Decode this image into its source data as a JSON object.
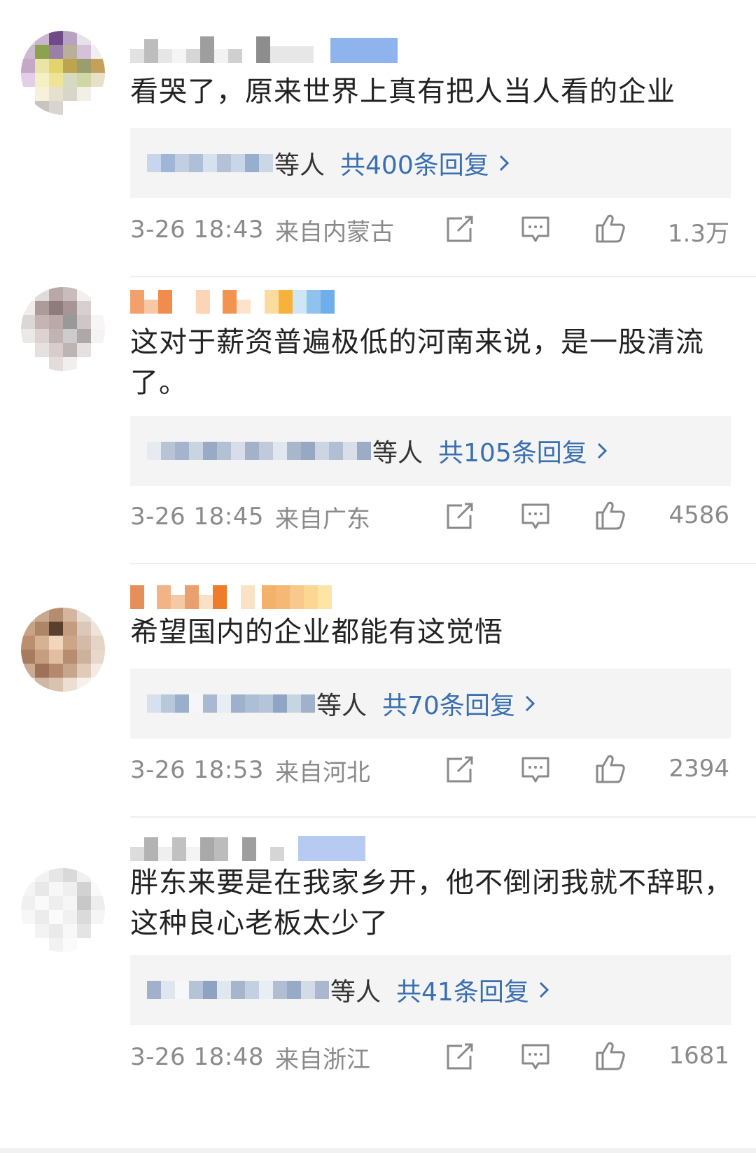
{
  "comments": [
    {
      "text": "看哭了，原来世界上真有把人当人看的企业",
      "reply_etc": "等人",
      "reply_total": "共400条回复",
      "time": "3-26 18:43",
      "origin": "来自内蒙古",
      "likes": "1.3万"
    },
    {
      "text": "这对于薪资普遍极低的河南来说，是一股清流了。",
      "reply_etc": "等人",
      "reply_total": "共105条回复",
      "time": "3-26 18:45",
      "origin": "来自广东",
      "likes": "4586"
    },
    {
      "text": "希望国内的企业都能有这觉悟",
      "reply_etc": "等人",
      "reply_total": "共70条回复",
      "time": "3-26 18:53",
      "origin": "来自河北",
      "likes": "2394"
    },
    {
      "text": "胖东来要是在我家乡开，他不倒闭我就不辞职，这种良心老板太少了",
      "reply_etc": "等人",
      "reply_total": "共41条回复",
      "time": "3-26 18:48",
      "origin": "来自浙江",
      "likes": "1681"
    }
  ],
  "icons": {
    "share": "share-icon",
    "comment": "comment-icon",
    "like": "thumbs-up-icon",
    "chevron": "chevron-right-icon"
  },
  "colors": {
    "reply_link": "#3a6fb0",
    "meta_text": "#8a8a8a",
    "reply_bg": "#f4f4f4"
  }
}
